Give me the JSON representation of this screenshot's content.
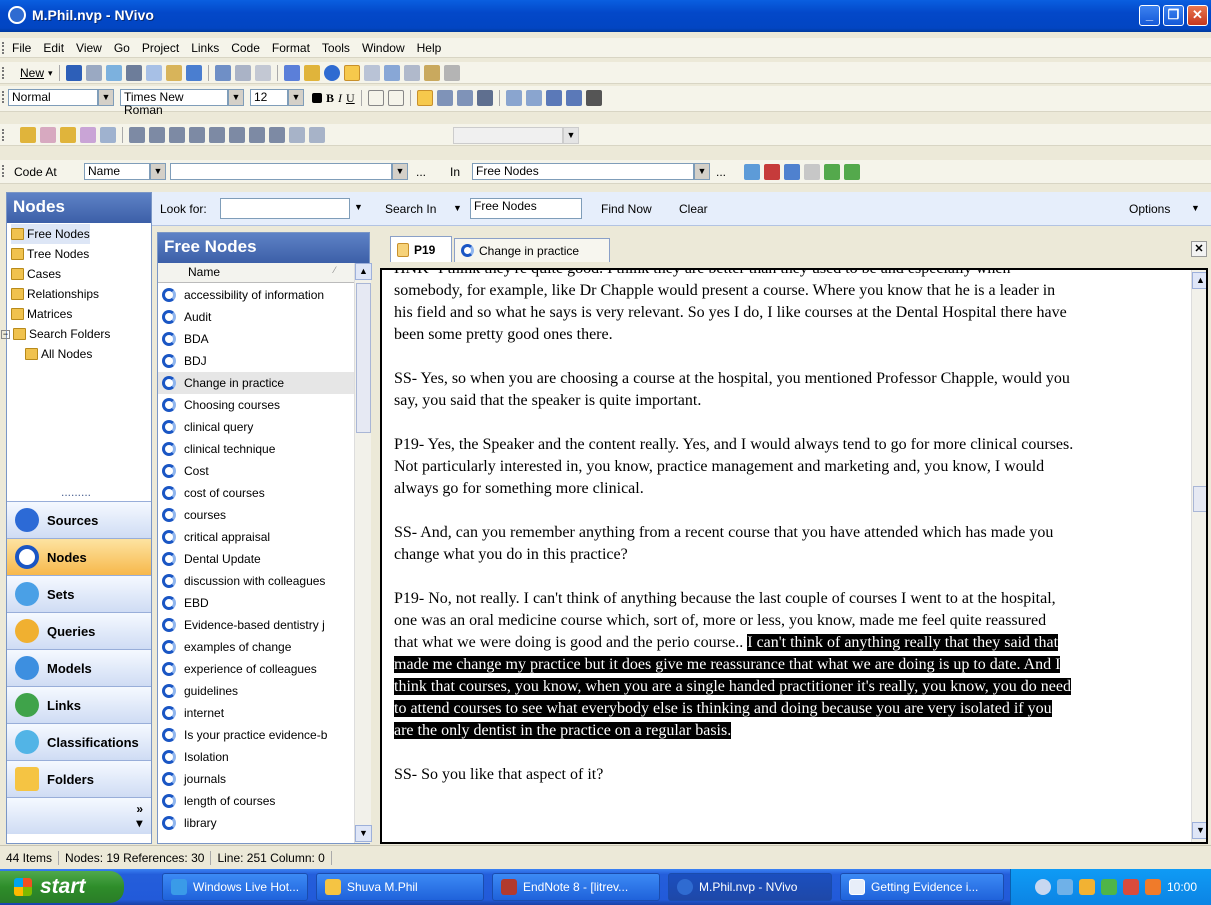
{
  "window": {
    "title": "M.Phil.nvp - NVivo"
  },
  "menu": [
    "File",
    "Edit",
    "View",
    "Go",
    "Project",
    "Links",
    "Code",
    "Format",
    "Tools",
    "Window",
    "Help"
  ],
  "toolbar": {
    "new_label": "New"
  },
  "format_bar": {
    "style": "Normal",
    "font": "Times New Roman",
    "size": "12"
  },
  "code_bar": {
    "code_at": "Code At",
    "name_field": "Name",
    "ellipsis": "...",
    "in_label": "In",
    "in_value": "Free Nodes"
  },
  "nav": {
    "title": "Nodes",
    "tree": [
      "Free Nodes",
      "Tree Nodes",
      "Cases",
      "Relationships",
      "Matrices",
      "Search Folders",
      "All Nodes"
    ],
    "buttons": [
      "Sources",
      "Nodes",
      "Sets",
      "Queries",
      "Models",
      "Links",
      "Classifications",
      "Folders"
    ],
    "dots": "........."
  },
  "find_bar": {
    "look_for": "Look for:",
    "search_in": "Search In",
    "search_in_value": "Free Nodes",
    "find_now": "Find Now",
    "clear": "Clear",
    "options": "Options"
  },
  "list": {
    "title": "Free Nodes",
    "column": "Name",
    "items": [
      "accessibility of information",
      "Audit",
      "BDA",
      "BDJ",
      "Change in practice",
      "Choosing courses",
      "clinical query",
      "clinical technique",
      "Cost",
      "cost of courses",
      "courses",
      "critical appraisal",
      "Dental Update",
      "discussion with colleagues",
      "EBD",
      "Evidence-based dentistry j",
      "examples of change",
      "experience of colleagues",
      "guidelines",
      "internet",
      "Is your practice evidence-b",
      "Isolation",
      "journals",
      "length of courses",
      "library"
    ]
  },
  "tabs": [
    "P19",
    "Change in practice"
  ],
  "document": {
    "cut_line": "HNK-  I think they're quite good.  I think they are better than they used to be and",
    "p1": "especially when somebody, for example, like Dr Chapple would present a course.  Where you know that he is a leader in his field and so what he says is very relevant.  So yes I do, I like courses at the Dental Hospital there have been some pretty good ones there.",
    "p2": "SS-  Yes, so when you are choosing a course at the hospital, you mentioned Professor Chapple, would you say, you said that the speaker is quite important.",
    "p3": "P19-  Yes, the Speaker and the content really.  Yes, and I would always tend to go for more clinical courses.  Not particularly interested in, you know, practice management and marketing and, you know, I would always go for something more clinical.",
    "p4": "SS-  And, can you remember anything from a recent course that you have attended which has made you change what you do in this practice?",
    "p5_plain": "P19-  No, not really.  I can't think of anything because the last couple of courses I went to at the hospital, one was an oral medicine course which, sort of, more or less, you know, made me feel quite reassured that what we were doing is good and the perio course.. ",
    "p5_highlight": "I can't think of anything really that they said that made me change my practice but it does give me reassurance that what we are doing is up to date.  And I think that courses, you know, when you are a single handed practitioner it's really, you know, you do need to attend courses to see what everybody else is thinking and doing because you are very isolated if you are the only dentist in the practice on a regular basis.",
    "p6": "SS-  So you like that aspect of it?"
  },
  "status": {
    "items": "44 Items",
    "nodes": "Nodes: 19 References: 30",
    "position": "Line: 251 Column: 0"
  },
  "taskbar": {
    "start": "start",
    "tasks": [
      "Windows Live Hot...",
      "Shuva M.Phil",
      "EndNote 8 - [litrev...",
      "M.Phil.nvp - NVivo",
      "Getting Evidence i..."
    ],
    "clock": "10:00"
  }
}
